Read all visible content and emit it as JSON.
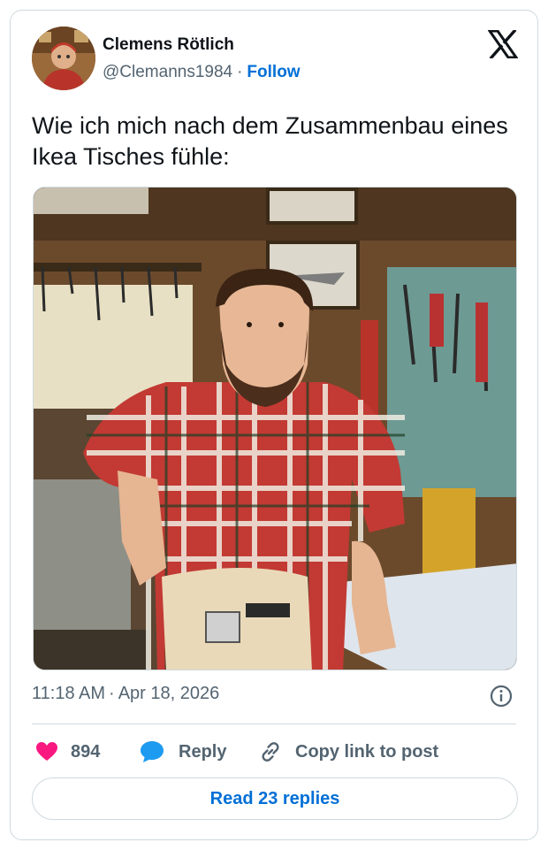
{
  "author": {
    "display_name": "Clemens Rötlich",
    "handle": "@Clemanns1984",
    "separator": "·",
    "follow_label": "Follow"
  },
  "tweet": {
    "text": "Wie ich mich nach dem Zusammenbau eines Ikea Tisches fühle:"
  },
  "meta": {
    "time": "11:18 AM",
    "separator": "·",
    "date": "Apr 18, 2026"
  },
  "actions": {
    "likes_count": "894",
    "reply_label": "Reply",
    "copy_link_label": "Copy link to post"
  },
  "read_replies_label": "Read 23 replies",
  "icons": {
    "brand": "x-logo-icon",
    "info": "info-icon",
    "like": "heart-icon",
    "reply": "speech-bubble-icon",
    "copy": "link-icon"
  },
  "colors": {
    "link_blue": "#006fd6",
    "like_pink": "#f91880",
    "reply_blue": "#1d9bf0",
    "muted_text": "#536471",
    "border": "#cfd9de"
  }
}
